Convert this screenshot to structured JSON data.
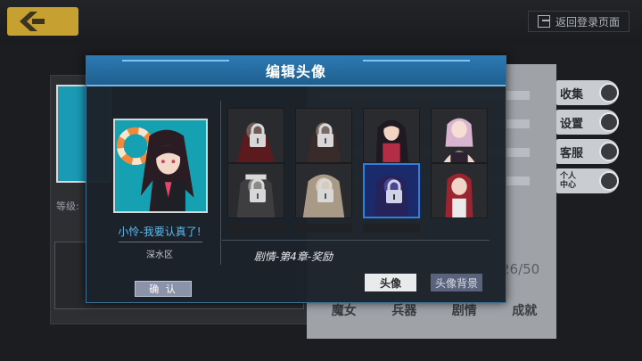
{
  "topbar": {
    "back_icon": "back-arrow-icon",
    "return_login": "返回登录页面"
  },
  "background": {
    "level_label": "等级:",
    "side_menu": [
      {
        "label": "收集",
        "icon": "clock-icon"
      },
      {
        "label": "设置",
        "icon": "gear-icon"
      },
      {
        "label": "客服",
        "icon": "headset-icon"
      },
      {
        "label": "个人\n中心",
        "icon": "user-icon"
      }
    ],
    "bottom_labels": [
      "魔女",
      "兵器",
      "剧情",
      "成就"
    ],
    "count": "26/50"
  },
  "dialog": {
    "title": "编辑头像",
    "selected": {
      "name": "小怜-我要认真了!",
      "area": "深水区"
    },
    "source": "剧情-第4章-奖励",
    "confirm": "确 认",
    "tabs": {
      "avatar": "头像",
      "avatar_bg": "头像背景"
    }
  },
  "colors": {
    "header_blue": "#2c79b3",
    "name_blue": "#5db9f0",
    "selected_border": "#2d7fe0",
    "back_gold": "#c7a032"
  }
}
